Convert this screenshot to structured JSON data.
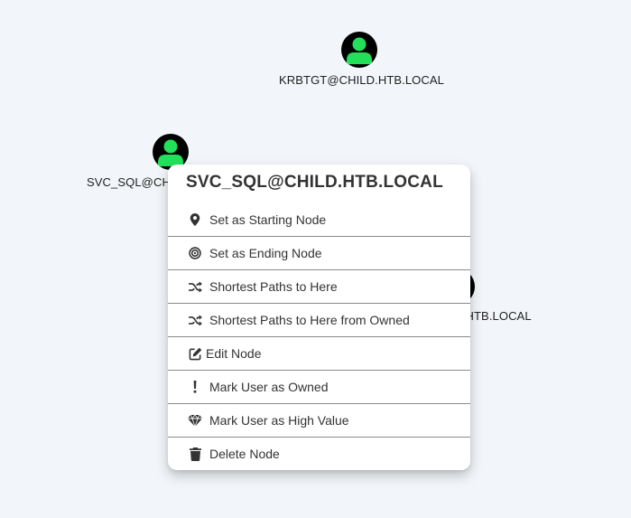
{
  "graph": {
    "nodes": [
      {
        "label": "KRBTGT@CHILD.HTB.LOCAL",
        "icon": "user-icon"
      },
      {
        "label": "SVC_SQL@CH",
        "icon": "user-icon"
      },
      {
        "label": "@CHILD.HTB.LOCAL",
        "icon": "user-icon"
      }
    ],
    "colors": {
      "node_bg": "#000000",
      "user_fill": "#22e05a",
      "background": "#f2f5f9"
    }
  },
  "context_menu": {
    "title": "SVC_SQL@CHILD.HTB.LOCAL",
    "items": [
      {
        "label": "Set as Starting Node",
        "icon": "map-marker-icon"
      },
      {
        "label": "Set as Ending Node",
        "icon": "bullseye-icon"
      },
      {
        "label": "Shortest Paths to Here",
        "icon": "random-icon"
      },
      {
        "label": "Shortest Paths to Here from Owned",
        "icon": "random-icon"
      },
      {
        "label": "Edit Node",
        "icon": "edit-icon"
      },
      {
        "label": "Mark User as Owned",
        "icon": "exclamation-icon"
      },
      {
        "label": "Mark User as High Value",
        "icon": "gem-icon"
      },
      {
        "label": "Delete Node",
        "icon": "trash-icon"
      }
    ]
  }
}
